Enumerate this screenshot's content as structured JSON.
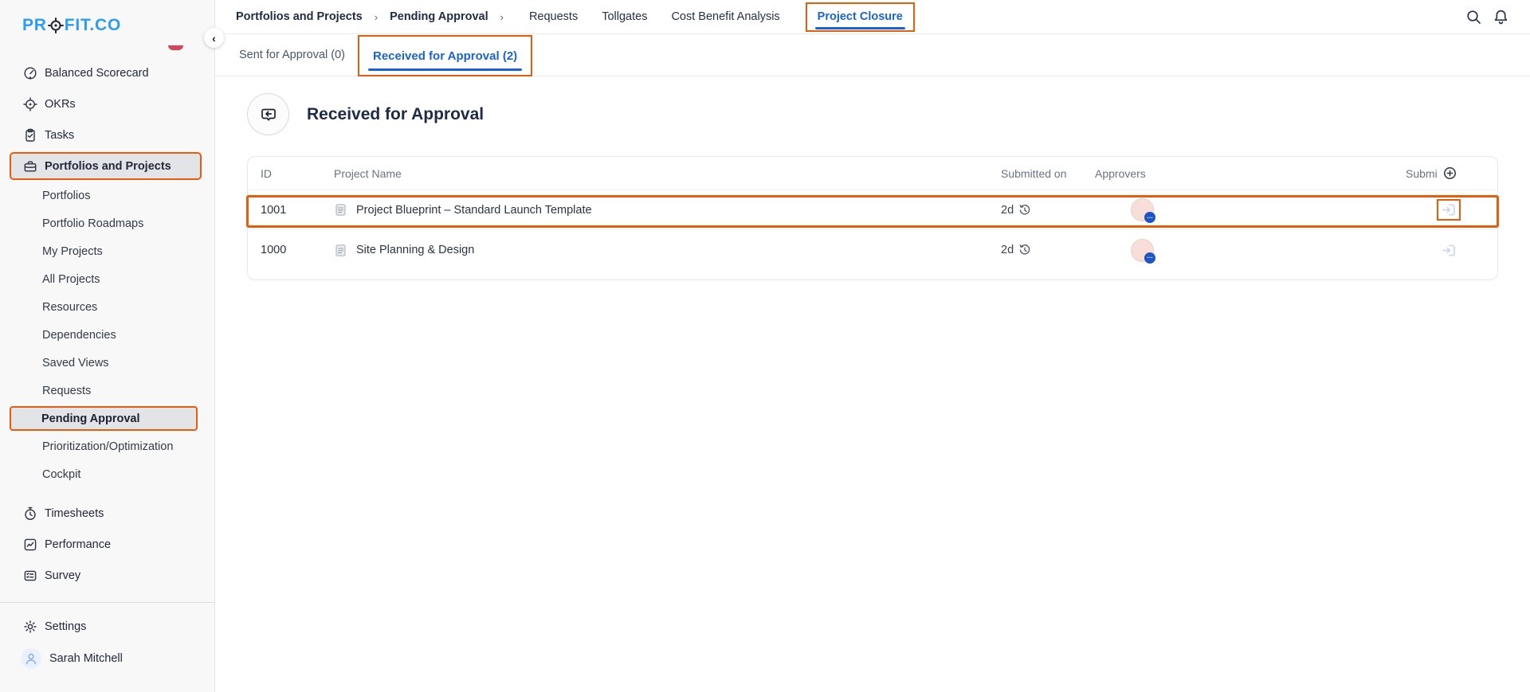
{
  "brand": {
    "logo_left": "PR",
    "logo_right": "FIT.CO"
  },
  "colors": {
    "accent_orange": "#e85d0b",
    "active_blue": "#1a63d6",
    "navy_text": "#1f2a44",
    "logo_blue": "#2d9cf4",
    "sidebar_bg": "#f8f8f9",
    "avatar_pink": "#f7ded9",
    "badge_blue": "#1d55c4"
  },
  "sidebar": {
    "collapse": "‹",
    "top_items": [
      {
        "label": "Balanced Scorecard"
      },
      {
        "label": "OKRs"
      },
      {
        "label": "Tasks"
      },
      {
        "label": "Portfolios and Projects"
      }
    ],
    "sub_items": [
      {
        "label": "Portfolios"
      },
      {
        "label": "Portfolio Roadmaps"
      },
      {
        "label": "My Projects"
      },
      {
        "label": "All Projects"
      },
      {
        "label": "Resources"
      },
      {
        "label": "Dependencies"
      },
      {
        "label": "Saved Views"
      },
      {
        "label": "Requests"
      },
      {
        "label": "Pending Approval"
      },
      {
        "label": "Prioritization/Optimization"
      },
      {
        "label": "Cockpit"
      }
    ],
    "bottom_items": [
      {
        "label": "Timesheets"
      },
      {
        "label": "Performance"
      },
      {
        "label": "Survey"
      }
    ],
    "footer": {
      "settings": "Settings",
      "user": "Sarah Mitchell"
    }
  },
  "topnav": {
    "breadcrumb": [
      {
        "label": "Portfolios and Projects"
      },
      {
        "label": "Pending Approval"
      }
    ],
    "separator": "›",
    "tabs": [
      {
        "label": "Requests"
      },
      {
        "label": "Tollgates"
      },
      {
        "label": "Cost Benefit Analysis"
      },
      {
        "label": "Project Closure",
        "active": true
      }
    ]
  },
  "subtabs": [
    {
      "label": "Sent for Approval (0)"
    },
    {
      "label": "Received for Approval (2)",
      "active": true
    }
  ],
  "page": {
    "title": "Received for Approval"
  },
  "table": {
    "headers": {
      "id": "ID",
      "name": "Project Name",
      "submitted": "Submitted on",
      "approvers": "Approvers",
      "last": "Submi"
    },
    "rows": [
      {
        "id": "1001",
        "name": "Project Blueprint – Standard Launch Template",
        "submitted": "2d",
        "approver_badge": "…"
      },
      {
        "id": "1000",
        "name": "Site Planning & Design",
        "submitted": "2d",
        "approver_badge": "…"
      }
    ]
  }
}
